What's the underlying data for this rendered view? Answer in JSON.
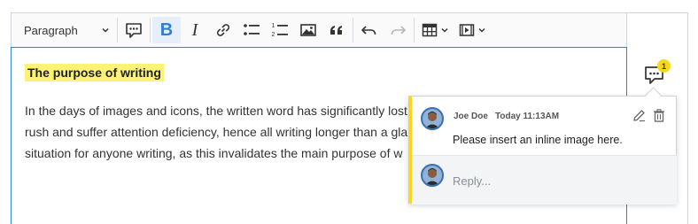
{
  "toolbar": {
    "heading_dropdown": {
      "value": "Paragraph",
      "icon": "chevron-down-icon"
    },
    "buttons": [
      {
        "name": "comment",
        "icon": "comment-icon"
      },
      {
        "name": "bold",
        "icon": "bold-icon",
        "glyph": "B",
        "active": true
      },
      {
        "name": "italic",
        "icon": "italic-icon",
        "glyph": "I"
      },
      {
        "name": "link",
        "icon": "link-icon"
      },
      {
        "name": "bulleted-list",
        "icon": "bulleted-list-icon"
      },
      {
        "name": "numbered-list",
        "icon": "numbered-list-icon",
        "numbers": [
          "1",
          "2"
        ]
      },
      {
        "name": "insert-image",
        "icon": "image-icon"
      },
      {
        "name": "block-quote",
        "icon": "quote-icon"
      },
      {
        "name": "undo",
        "icon": "undo-icon"
      },
      {
        "name": "redo",
        "icon": "redo-icon",
        "disabled": true
      },
      {
        "name": "insert-table",
        "icon": "table-icon"
      },
      {
        "name": "insert-media",
        "icon": "media-icon"
      }
    ]
  },
  "document": {
    "heading": "The purpose of writing",
    "paragraph_lines": [
      "In the days of images and icons, the written word has significantly lost",
      "rush and suffer attention deficiency, hence all writing longer than a gla",
      "situation for anyone writing, as this invalidates the main purpose of w"
    ]
  },
  "comments_sidebar": {
    "marker_count": "1",
    "thread": {
      "author": "Joe Doe",
      "time": "Today 11:13AM",
      "text": "Please insert an inline image here.",
      "reply_placeholder": "Reply..."
    }
  },
  "colors": {
    "highlight": "#fcf375",
    "accent": "#2f80d1",
    "badge": "#f9d71c",
    "active_button_bg": "#e6eef9"
  }
}
